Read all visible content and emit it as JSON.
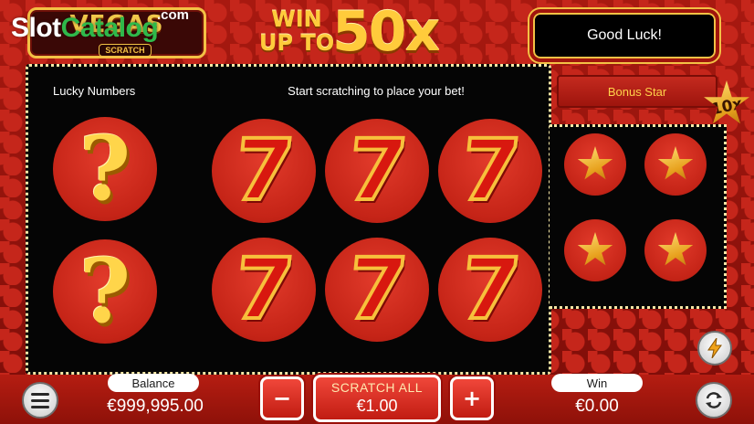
{
  "header": {
    "logo_title": "VEGAS",
    "logo_subtitle": "SCRATCH",
    "watermark_part1": "Slot",
    "watermark_part2": "Catalog",
    "watermark_tld": ".com",
    "promo_line1": "WIN\nUP TO",
    "promo_multiplier": "50x",
    "message": "Good Luck!"
  },
  "board": {
    "lucky_numbers_label": "Lucky Numbers",
    "instruction": "Start scratching to place your bet!",
    "lucky_symbols": [
      "?",
      "?"
    ],
    "symbols": [
      "7",
      "7",
      "7",
      "7",
      "7",
      "7"
    ]
  },
  "bonus": {
    "label": "Bonus Star",
    "multiplier": "10x",
    "stars": [
      "star",
      "star",
      "star",
      "star"
    ]
  },
  "footer": {
    "balance_label": "Balance",
    "balance_value": "€999,995.00",
    "minus_label": "−",
    "plus_label": "+",
    "scratch_all_label": "SCRATCH ALL",
    "bet_value": "€1.00",
    "win_label": "Win",
    "win_value": "€0.00"
  },
  "icons": {
    "menu": "menu-icon",
    "turbo": "lightning-icon",
    "autoplay": "repeat-icon"
  },
  "colors": {
    "background_red": "#a81910",
    "board_black": "#050505",
    "gold": "#ffcb3b",
    "bonus_text": "#ffd24a"
  }
}
